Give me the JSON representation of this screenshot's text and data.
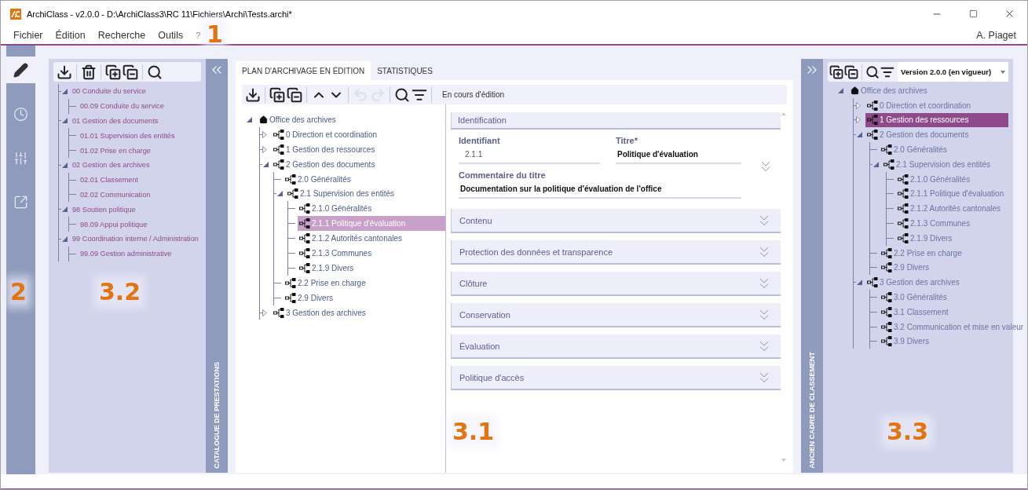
{
  "window": {
    "title": "ArchiClass - v2.0.0 - D:\\ArchiClass3\\RC 11\\Fichiers\\Archi\\Tests.archi*"
  },
  "menu": [
    {
      "label": "Fichier"
    },
    {
      "label": "Édition"
    },
    {
      "label": "Recherche"
    },
    {
      "label": "Outils"
    },
    {
      "label": "?"
    }
  ],
  "user": "A. Piaget",
  "nav": [
    {
      "kind": "edit",
      "selected": true
    },
    {
      "kind": "history",
      "selected": false
    },
    {
      "kind": "settings",
      "selected": false
    },
    {
      "kind": "export",
      "selected": false
    }
  ],
  "catalogue": {
    "title": "CATALOGUE DE PRESTATIONS",
    "toolbar": [
      [
        {
          "kind": "download"
        }
      ],
      [
        {
          "kind": "delete"
        }
      ],
      [
        {
          "kind": "expand"
        },
        {
          "kind": "collapse"
        }
      ],
      [
        {
          "kind": "search"
        }
      ]
    ],
    "tree": [
      {
        "label": "00 Conduite du service",
        "expanded": true,
        "selected": false,
        "children": [
          {
            "label": "00.09 Conduite du service",
            "selected": false
          }
        ]
      },
      {
        "label": "01 Gestion des documents",
        "expanded": true,
        "selected": false,
        "children": [
          {
            "label": "01.01 Supervision des entités",
            "selected": false
          },
          {
            "label": "01.02 Prise en charge",
            "selected": false
          }
        ]
      },
      {
        "label": "02 Gestion des archives",
        "expanded": true,
        "selected": false,
        "children": [
          {
            "label": "02.01 Classement",
            "selected": false
          },
          {
            "label": "02.02 Communication",
            "selected": false
          }
        ]
      },
      {
        "label": "98 Soutien politique",
        "expanded": true,
        "selected": false,
        "children": [
          {
            "label": "98.09 Appui politique",
            "selected": false
          }
        ]
      },
      {
        "label": "99 Coordination interne / Administration",
        "expanded": true,
        "selected": false,
        "children": [
          {
            "label": "99.09 Gestion administrative",
            "selected": false
          }
        ]
      }
    ]
  },
  "editor": {
    "tabs": [
      {
        "label": "PLAN D'ARCHIVAGE EN ÉDITION",
        "selected": true
      },
      {
        "label": "STATISTIQUES",
        "selected": false
      }
    ],
    "toolbar": [
      [
        {
          "kind": "download",
          "disabled": false
        }
      ],
      [
        {
          "kind": "expand",
          "disabled": false
        },
        {
          "kind": "collapse",
          "disabled": false
        }
      ],
      [
        {
          "kind": "up",
          "disabled": false
        },
        {
          "kind": "down",
          "disabled": false
        }
      ],
      [
        {
          "kind": "undo",
          "disabled": true
        },
        {
          "kind": "redo",
          "disabled": true
        }
      ],
      [
        {
          "kind": "search",
          "disabled": false
        },
        {
          "kind": "filter",
          "disabled": false
        }
      ]
    ],
    "status": "En cours d'édition",
    "tree": [
      {
        "label": "Office des archives",
        "expanded": true,
        "selected": false,
        "children": [
          {
            "label": "0 Direction et coordination",
            "expanded": false,
            "selected": false
          },
          {
            "label": "1 Gestion des ressources",
            "expanded": false,
            "selected": false
          },
          {
            "label": "2 Gestion des documents",
            "expanded": true,
            "selected": false,
            "children": [
              {
                "label": "2.0 Généralités",
                "selected": false
              },
              {
                "label": "2.1 Supervision des entités",
                "expanded": true,
                "selected": false,
                "children": [
                  {
                    "label": "2.1.0 Généralités",
                    "selected": false
                  },
                  {
                    "label": "2.1.1 Politique d'évaluation",
                    "selected": true
                  },
                  {
                    "label": "2.1.2 Autorités cantonales",
                    "selected": false
                  },
                  {
                    "label": "2.1.3 Communes",
                    "selected": false
                  },
                  {
                    "label": "2.1.9 Divers",
                    "selected": false
                  }
                ]
              },
              {
                "label": "2.2 Prise en charge",
                "selected": false
              },
              {
                "label": "2.9 Divers",
                "selected": false
              }
            ]
          },
          {
            "label": "3 Gestion des archives",
            "expanded": false,
            "selected": false
          }
        ]
      }
    ],
    "form": {
      "sections": [
        {
          "title": "Identification",
          "expanded": true,
          "fields": [
            {
              "label": "Identifiant",
              "value": "2.1.1",
              "disabled": true
            },
            {
              "label": "Titre*",
              "value": "Politique d'évaluation",
              "disabled": false
            },
            {
              "label": "Commentaire du titre",
              "value": "Documentation sur la politique d'évaluation de l'office",
              "disabled": false
            }
          ]
        },
        {
          "title": "Contenu",
          "expanded": false
        },
        {
          "title": "Protection des données et transparence",
          "expanded": false
        },
        {
          "title": "Clôture",
          "expanded": false
        },
        {
          "title": "Conservation",
          "expanded": false
        },
        {
          "title": "Évaluation",
          "expanded": false
        },
        {
          "title": "Politique d'accès",
          "expanded": false
        }
      ]
    }
  },
  "old_frame": {
    "title": "ANCIEN CADRE DE CLASSEMENT",
    "toolbar": [
      [
        {
          "kind": "expand"
        },
        {
          "kind": "collapse"
        }
      ],
      [
        {
          "kind": "search"
        },
        {
          "kind": "filter"
        }
      ]
    ],
    "version": "Version 2.0.0 (en vigueur)",
    "tree": [
      {
        "label": "Office des archives",
        "expanded": true,
        "selected": false,
        "children": [
          {
            "label": "0 Direction et coordination",
            "expanded": false,
            "selected": false
          },
          {
            "label": "1 Gestion des ressources",
            "expanded": false,
            "selected": true
          },
          {
            "label": "2 Gestion des documents",
            "expanded": true,
            "selected": false,
            "children": [
              {
                "label": "2.0 Généralités",
                "selected": false
              },
              {
                "label": "2.1 Supervision des entités",
                "expanded": true,
                "selected": false,
                "children": [
                  {
                    "label": "2.1.0 Généralités",
                    "selected": false
                  },
                  {
                    "label": "2.1.1 Politique d'évaluation",
                    "selected": false
                  },
                  {
                    "label": "2.1.2 Autorités cantonales",
                    "selected": false
                  },
                  {
                    "label": "2.1.3 Communes",
                    "selected": false
                  },
                  {
                    "label": "2.1.9 Divers",
                    "selected": false
                  }
                ]
              },
              {
                "label": "2.2 Prise en charge",
                "selected": false
              },
              {
                "label": "2.9 Divers",
                "selected": false
              }
            ]
          },
          {
            "label": "3 Gestion des archives",
            "expanded": true,
            "selected": false,
            "children": [
              {
                "label": "3.0 Généralités",
                "selected": false
              },
              {
                "label": "3.1 Classement",
                "selected": false
              },
              {
                "label": "3.2 Communication et mise en valeur",
                "selected": false
              },
              {
                "label": "3.9 Divers",
                "selected": false
              }
            ]
          }
        ]
      }
    ]
  },
  "annotations": [
    {
      "label": "1"
    },
    {
      "label": "2"
    },
    {
      "label": "3.2"
    },
    {
      "label": "3.1"
    },
    {
      "label": "3.3"
    }
  ]
}
